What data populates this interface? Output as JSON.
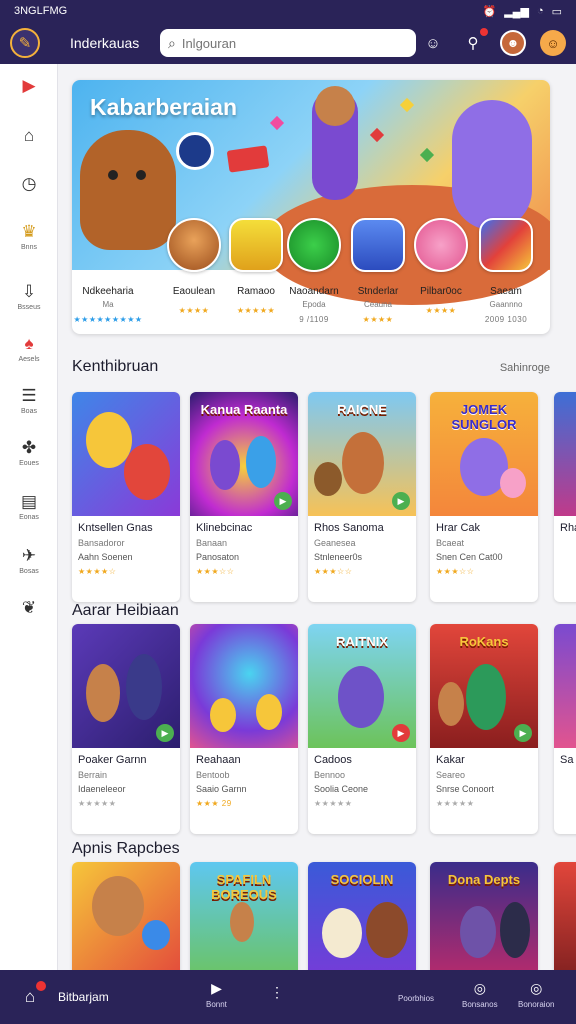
{
  "status_bar": {
    "left_text": "3NGLFMG",
    "icons": [
      "alarm-icon",
      "signal-icon",
      "wifi-icon",
      "battery-icon"
    ],
    "battery_label": ""
  },
  "header": {
    "title": "Inderkauas",
    "search": {
      "placeholder": "Inlgouran",
      "value": ""
    },
    "actions": [
      "smile-icon",
      "user-notification-icon",
      "avatar-icon",
      "face-icon"
    ]
  },
  "sidebar": {
    "items": [
      {
        "icon": "youtube-icon",
        "label": ""
      },
      {
        "icon": "home-icon",
        "label": ""
      },
      {
        "icon": "clock-icon",
        "label": ""
      },
      {
        "icon": "trophy-icon",
        "label": "Bnns"
      },
      {
        "icon": "download-icon",
        "label": "Bsseus"
      },
      {
        "icon": "gamepad-icon",
        "label": "Aesels"
      },
      {
        "icon": "list-icon",
        "label": "Boas"
      },
      {
        "icon": "puzzle-icon",
        "label": "Eoues"
      },
      {
        "icon": "news-icon",
        "label": "Eonas"
      },
      {
        "icon": "rocket-icon",
        "label": "Bosas"
      },
      {
        "icon": "leaf-icon",
        "label": ""
      }
    ]
  },
  "banner": {
    "title": "Kabarberaian",
    "badge_text": "",
    "featured": [
      {
        "name": "Ndkeeharia",
        "sub": "Ma",
        "rating": "★★★★★★★★★",
        "rating_color": "#2b9ce8"
      },
      {
        "name": "Eaoulean",
        "sub": "",
        "rating": "★★★★",
        "rating_color": "#f0a81e"
      },
      {
        "name": "Ramaoo",
        "sub": "",
        "rating": "★★★★★",
        "rating_color": "#f0a81e"
      },
      {
        "name": "Naoandarn",
        "sub": "Epoda",
        "rating": "9 /1109",
        "rating_color": "#777777"
      },
      {
        "name": "Stnderlar",
        "sub": "Ceauna",
        "rating": "★★★★",
        "rating_color": "#f0a81e"
      },
      {
        "name": "Pilbar0oc",
        "sub": "",
        "rating": "★★★★",
        "rating_color": "#f0a81e"
      },
      {
        "name": "Saeam",
        "sub": "Gaannno",
        "rating": "2009 1030",
        "rating_color": "#777777"
      }
    ]
  },
  "sections": [
    {
      "title": "Kenthibruan",
      "link": "Sahinroge",
      "cards": [
        {
          "caption": "",
          "name": "Kntsellen Gnas",
          "sub": "Bansadoror",
          "sub2": "Aahn Soenen",
          "rating": "★★★★☆"
        },
        {
          "caption": "Kanua Raanta",
          "name": "Klinebcinac",
          "sub": "Banaan",
          "sub2": "Panosaton",
          "rating": "★★★☆☆"
        },
        {
          "caption": "RAICNE",
          "name": "Rhos Sanoma",
          "sub": "Geanesea",
          "sub2": "Stnleneer0s",
          "rating": "★★★☆☆"
        },
        {
          "caption": "JOMEK SUNGLOR",
          "name": "Hrar Cak",
          "sub": "Bcaeat",
          "sub2": "Snen Cen Cat00",
          "rating": "★★★☆☆"
        },
        {
          "caption": "",
          "name": "Rha",
          "sub": "",
          "sub2": "",
          "rating": ""
        }
      ]
    },
    {
      "title": "Aarar Heibiaan",
      "link": "",
      "cards": [
        {
          "caption": "",
          "name": "Poaker Garnn",
          "sub": "Berrain",
          "sub2": "Idaeneleeor",
          "rating": "★★★★★"
        },
        {
          "caption": "",
          "name": "Reahaan",
          "sub": "Bentoob",
          "sub2": "Saaio Garnn",
          "rating": "★★★ 29"
        },
        {
          "caption": "RAITNIX",
          "name": "Cadoos",
          "sub": "Bennoo",
          "sub2": "Soolia Ceone",
          "rating": "★★★★★"
        },
        {
          "caption": "RoKans",
          "name": "Kakar",
          "sub": "Seareo",
          "sub2": "Snrse Conoort",
          "rating": "★★★★★"
        },
        {
          "caption": "",
          "name": "Sa",
          "sub": "",
          "sub2": "",
          "rating": ""
        }
      ]
    },
    {
      "title": "Apnis Rapcbes",
      "link": "",
      "cards": [
        {
          "caption": "",
          "name": "",
          "sub": "",
          "sub2": "",
          "rating": ""
        },
        {
          "caption": "SPAFILN BOREOUS",
          "name": "",
          "sub": "",
          "sub2": "",
          "rating": ""
        },
        {
          "caption": "SOCIOLIN",
          "name": "",
          "sub": "",
          "sub2": "",
          "rating": ""
        },
        {
          "caption": "Dona Depts",
          "name": "",
          "sub": "",
          "sub2": "",
          "rating": ""
        },
        {
          "caption": "",
          "name": "",
          "sub": "",
          "sub2": "",
          "rating": ""
        }
      ]
    }
  ],
  "bottom_bar": {
    "label": "Bitbarjam",
    "tabs": [
      {
        "icon": "play-icon",
        "label": "Bonnt"
      },
      {
        "icon": "more-icon",
        "label": ""
      },
      {
        "icon": "",
        "label": "Poorbhios"
      },
      {
        "icon": "compass-icon",
        "label": "Bonsanos"
      },
      {
        "icon": "compass-icon",
        "label": "Bonoraion"
      }
    ]
  },
  "colors": {
    "header_bg": "#2a2358",
    "accent": "#f4b13b",
    "play_green": "#4caf50",
    "star": "#f0a81e"
  }
}
